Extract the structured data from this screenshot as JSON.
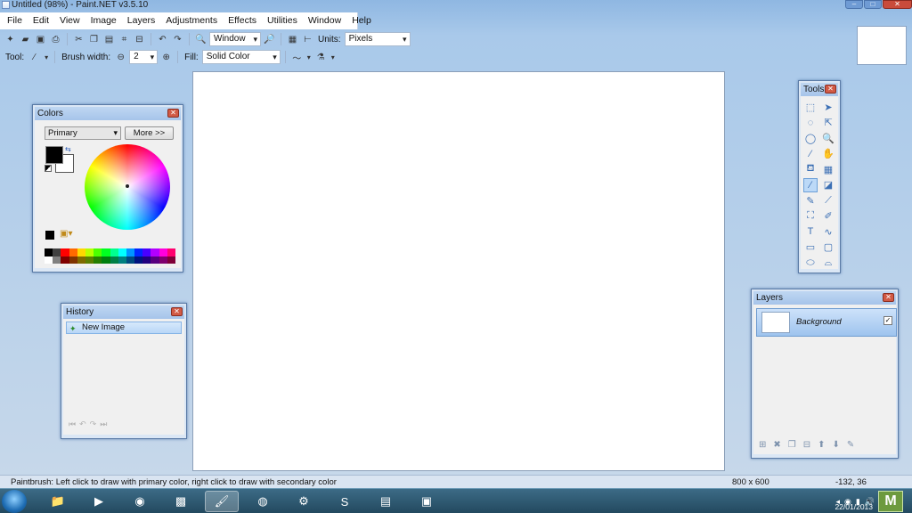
{
  "window": {
    "title": "Untitled (98%) - Paint.NET v3.5.10",
    "controls": [
      "–",
      "□",
      "✕"
    ]
  },
  "menu": [
    "File",
    "Edit",
    "View",
    "Image",
    "Layers",
    "Adjustments",
    "Effects",
    "Utilities",
    "Window",
    "Help"
  ],
  "toolbar": {
    "zoom_combo": "Window",
    "units_label": "Units:",
    "units_value": "Pixels",
    "tool_label": "Tool:",
    "brush_width_label": "Brush width:",
    "brush_width_value": "2",
    "fill_label": "Fill:",
    "fill_value": "Solid Color"
  },
  "colors_panel": {
    "title": "Colors",
    "mode": "Primary",
    "more_button": "More >>",
    "primary_color": "#000000",
    "secondary_color": "#ffffff",
    "palette": [
      "#000000",
      "#404040",
      "#ff0000",
      "#ff6a00",
      "#ffd800",
      "#b6ff00",
      "#4cff00",
      "#00ff21",
      "#00ff90",
      "#00ffff",
      "#0094ff",
      "#0026ff",
      "#4800ff",
      "#b200ff",
      "#ff00dc",
      "#ff006e",
      "#ffffff",
      "#808080",
      "#7f0000",
      "#7f3300",
      "#7f6a00",
      "#5b7f00",
      "#267f00",
      "#007f0e",
      "#007f46",
      "#007f7f",
      "#004a7f",
      "#00137f",
      "#21007f",
      "#57007f",
      "#7f006e",
      "#7f0037"
    ]
  },
  "history_panel": {
    "title": "History",
    "items": [
      "New Image"
    ]
  },
  "tools_panel": {
    "title": "Tools",
    "tools": [
      {
        "name": "rectangle-select",
        "glyph": "⬚"
      },
      {
        "name": "move-selected-pixels",
        "glyph": "➤"
      },
      {
        "name": "lasso-select",
        "glyph": "◌"
      },
      {
        "name": "move-selection",
        "glyph": "⇱"
      },
      {
        "name": "ellipse-select",
        "glyph": "◯"
      },
      {
        "name": "zoom",
        "glyph": "🔍"
      },
      {
        "name": "magic-wand",
        "glyph": "⁄"
      },
      {
        "name": "pan",
        "glyph": "✋"
      },
      {
        "name": "paint-bucket",
        "glyph": "⛾"
      },
      {
        "name": "gradient",
        "glyph": "▦"
      },
      {
        "name": "paintbrush",
        "glyph": "∕",
        "active": true
      },
      {
        "name": "eraser",
        "glyph": "◪"
      },
      {
        "name": "pencil",
        "glyph": "✎"
      },
      {
        "name": "color-picker",
        "glyph": "⟋"
      },
      {
        "name": "clone-stamp",
        "glyph": "⛶"
      },
      {
        "name": "recolor",
        "glyph": "✐"
      },
      {
        "name": "text",
        "glyph": "T"
      },
      {
        "name": "line-curve",
        "glyph": "∿"
      },
      {
        "name": "rectangle",
        "glyph": "▭"
      },
      {
        "name": "rounded-rectangle",
        "glyph": "▢"
      },
      {
        "name": "ellipse",
        "glyph": "⬭"
      },
      {
        "name": "freeform-shape",
        "glyph": "⌓"
      }
    ]
  },
  "layers_panel": {
    "title": "Layers",
    "layers": [
      {
        "name": "Background",
        "visible": true
      }
    ]
  },
  "status": {
    "message": "Paintbrush: Left click to draw with primary color, right click to draw with secondary color",
    "image_size": "800 x 600",
    "cursor": "-132, 36"
  },
  "taskbar": {
    "time": "",
    "date": "22/01/2013",
    "show_desktop_label": "M"
  }
}
